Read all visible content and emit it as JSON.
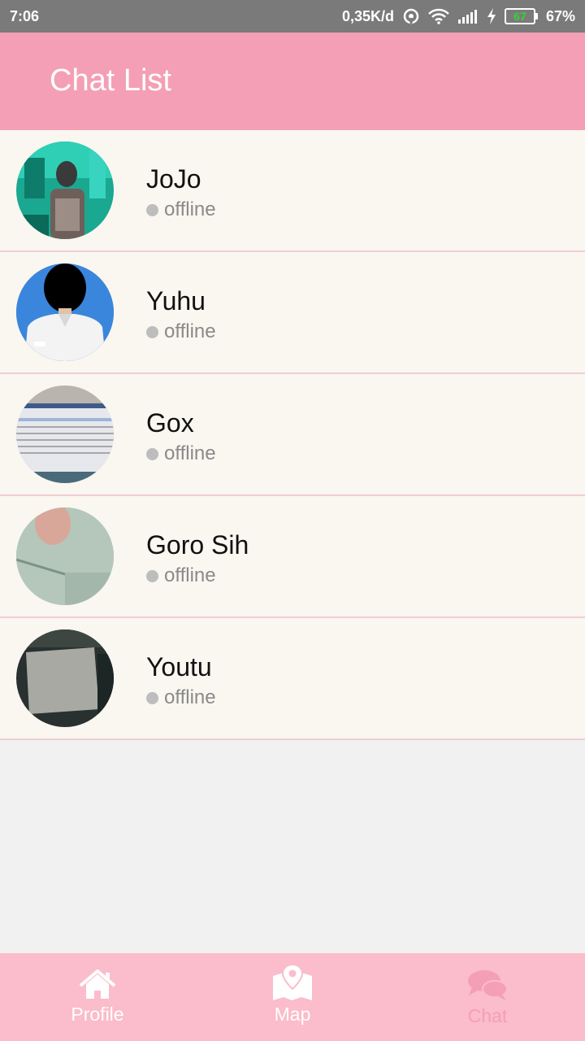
{
  "status_bar": {
    "time": "7:06",
    "network_speed": "0,35K/d",
    "battery_level": "67",
    "battery_percent": "67%"
  },
  "app_bar": {
    "title": "Chat List"
  },
  "chats": [
    {
      "name": "JoJo",
      "status": "offline",
      "avatar": "photo-avatar-teal"
    },
    {
      "name": "Yuhu",
      "status": "offline",
      "avatar": "photo-avatar-blue"
    },
    {
      "name": "Gox",
      "status": "offline",
      "avatar": "photo-avatar-screen"
    },
    {
      "name": "Goro Sih",
      "status": "offline",
      "avatar": "photo-avatar-green"
    },
    {
      "name": "Youtu",
      "status": "offline",
      "avatar": "photo-avatar-dark"
    }
  ],
  "bottom_nav": {
    "items": [
      {
        "label": "Profile",
        "icon": "home-icon",
        "active": false
      },
      {
        "label": "Map",
        "icon": "map-icon",
        "active": false
      },
      {
        "label": "Chat",
        "icon": "chat-icon",
        "active": true
      }
    ]
  },
  "colors": {
    "app_bar": "#f49fb6",
    "bottom_nav": "#fbbccb",
    "list_background": "#faf6f0",
    "divider": "#f0cdd6",
    "status_dot": "#bdbdbd"
  }
}
